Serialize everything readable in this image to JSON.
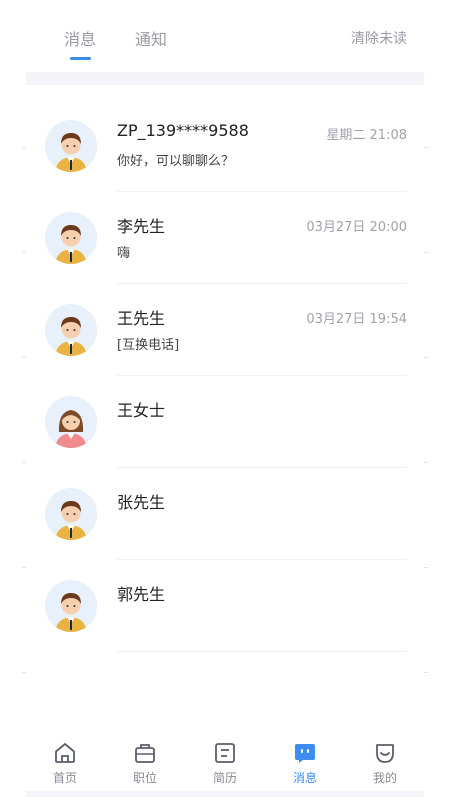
{
  "header": {
    "tabs": [
      {
        "label": "消息",
        "active": true
      },
      {
        "label": "通知",
        "active": false
      }
    ],
    "clear_label": "清除未读"
  },
  "conversations": [
    {
      "name": "ZP_139****9588",
      "time": "星期二 21:08",
      "preview": "你好，可以聊聊么？",
      "avatar": "male-avatar-icon"
    },
    {
      "name": "李先生",
      "time": "03月27日 20:00",
      "preview": "嗨",
      "avatar": "male-avatar-icon"
    },
    {
      "name": "王先生",
      "time": "03月27日 19:54",
      "preview": "[互换电话]",
      "avatar": "male-avatar-icon"
    },
    {
      "name": "王女士",
      "time": "",
      "preview": "",
      "avatar": "female-avatar-icon"
    },
    {
      "name": "张先生",
      "time": "",
      "preview": "",
      "avatar": "male-avatar-icon"
    },
    {
      "name": "郭先生",
      "time": "",
      "preview": "",
      "avatar": "male-avatar-icon"
    }
  ],
  "bottom_nav": [
    {
      "label": "首页",
      "icon": "home-icon",
      "active": false
    },
    {
      "label": "职位",
      "icon": "briefcase-icon",
      "active": false
    },
    {
      "label": "简历",
      "icon": "resume-icon",
      "active": false
    },
    {
      "label": "消息",
      "icon": "message-icon",
      "active": true
    },
    {
      "label": "我的",
      "icon": "profile-icon",
      "active": false
    }
  ],
  "colors": {
    "accent": "#3d8cf0",
    "muted_text": "#9a9aa6",
    "avatar_bg": "#e8f0fb",
    "male_shirt": "#e8b341",
    "female_shirt": "#ef8a8e"
  }
}
